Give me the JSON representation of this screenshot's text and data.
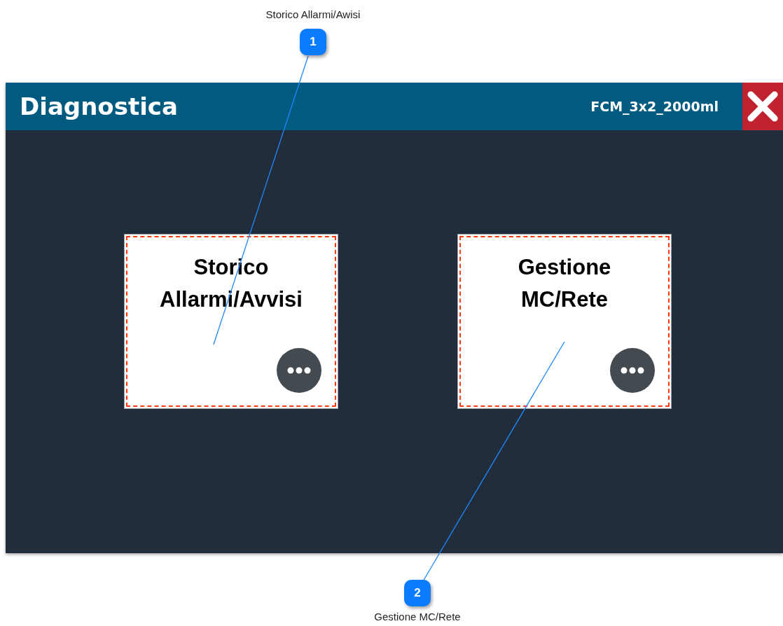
{
  "callouts": [
    {
      "number": "1",
      "label": "Storico Allarmi/Awisi"
    },
    {
      "number": "2",
      "label": "Gestione MC/Rete"
    }
  ],
  "window": {
    "title": "Diagnostica",
    "subtitle": "FCM_3x2_2000ml"
  },
  "tiles": [
    {
      "title": "Storico Allarmi/Avvisi"
    },
    {
      "title": "Gestione MC/Rete"
    }
  ]
}
